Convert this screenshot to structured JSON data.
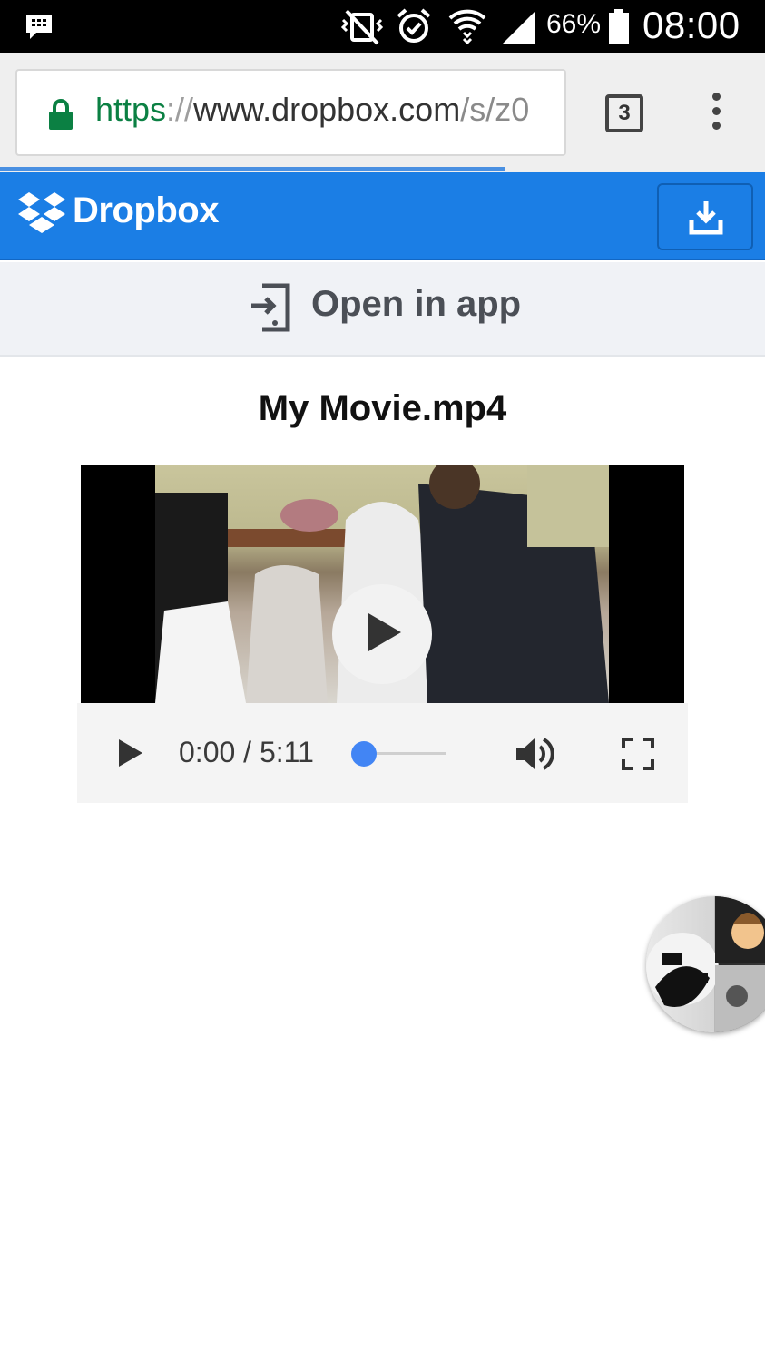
{
  "status_bar": {
    "battery_percent": "66%",
    "time": "08:00",
    "icons": [
      "bbm-icon",
      "mute-vibrate-icon",
      "alarm-icon",
      "wifi-icon",
      "signal-icon",
      "battery-icon"
    ]
  },
  "browser": {
    "url_scheme": "https",
    "url_separator": "://",
    "url_host": "www.dropbox.com",
    "url_path": "/s/z0",
    "tab_count": "3",
    "page_load_progress": 0.66
  },
  "dropbox": {
    "brand": "Dropbox",
    "brand_color": "#1b7ee5",
    "open_in_app_label": "Open in app"
  },
  "file": {
    "title": "My Movie.mp4"
  },
  "player": {
    "time_display": "0:00 / 5:11",
    "seek_position": 0.0,
    "accent_color": "#4285f4"
  }
}
